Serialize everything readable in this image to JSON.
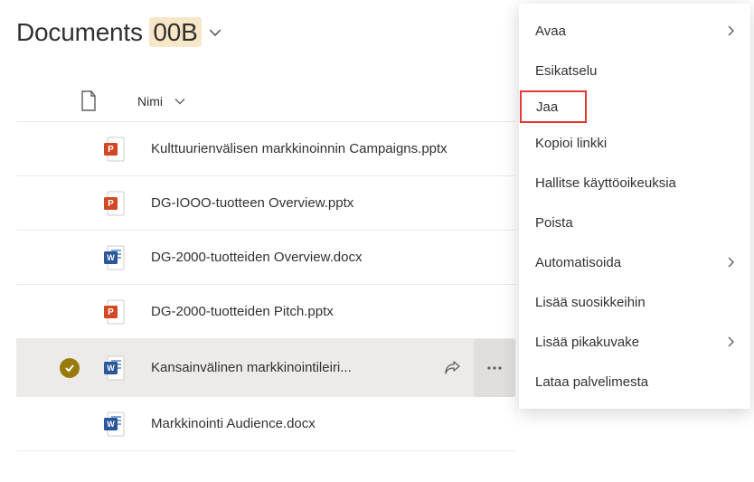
{
  "header": {
    "title_prefix": "Documents ",
    "title_highlight": "00B"
  },
  "columns": {
    "name": "Nimi"
  },
  "files": [
    {
      "type": "pptx",
      "name": "Kulttuurienvälisen markkinoinnin Campaigns.pptx",
      "selected": false
    },
    {
      "type": "pptx",
      "name": "DG-IOOO-tuotteen Overview.pptx",
      "selected": false
    },
    {
      "type": "docx",
      "name": "DG-2000-tuotteiden Overview.docx",
      "selected": false
    },
    {
      "type": "pptx",
      "name": "DG-2000-tuotteiden Pitch.pptx",
      "selected": false
    },
    {
      "type": "docx",
      "name": "Kansainvälinen markkinointileiri...",
      "selected": true
    },
    {
      "type": "docx",
      "name": "Markkinointi Audience.docx",
      "selected": false
    }
  ],
  "menu": [
    {
      "label": "Avaa",
      "submenu": true,
      "highlight": false
    },
    {
      "label": "Esikatselu",
      "submenu": false,
      "highlight": false
    },
    {
      "label": "Jaa",
      "submenu": false,
      "highlight": true
    },
    {
      "label": "Kopioi linkki",
      "submenu": false,
      "highlight": false
    },
    {
      "label": "Hallitse käyttöoikeuksia",
      "submenu": false,
      "highlight": false
    },
    {
      "label": "Poista",
      "submenu": false,
      "highlight": false
    },
    {
      "label": "Automatisoida",
      "submenu": true,
      "highlight": false
    },
    {
      "label": "Lisää suosikkeihin",
      "submenu": false,
      "highlight": false
    },
    {
      "label": "Lisää pikakuvake",
      "submenu": true,
      "highlight": false
    },
    {
      "label": "Lataa palvelimesta",
      "submenu": false,
      "highlight": false
    }
  ]
}
